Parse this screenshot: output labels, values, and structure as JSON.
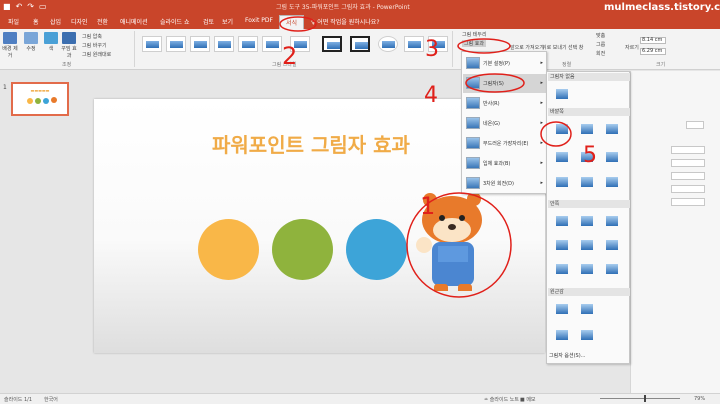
{
  "window": {
    "title": "그림 도구  35-파워포인트 그림자 효과 - PowerPoint",
    "watermark": "mulmeclass.tistory.com",
    "qat": [
      "save-icon",
      "undo-icon",
      "redo-icon",
      "present-icon"
    ],
    "qat_glyphs": [
      "■",
      "↶",
      "↷",
      "▭"
    ]
  },
  "tabs": [
    {
      "label": "파일"
    },
    {
      "label": "홈"
    },
    {
      "label": "삽입"
    },
    {
      "label": "디자인"
    },
    {
      "label": "전환"
    },
    {
      "label": "애니메이션"
    },
    {
      "label": "슬라이드 쇼"
    },
    {
      "label": "검토"
    },
    {
      "label": "보기"
    },
    {
      "label": "Foxit PDF"
    },
    {
      "label": "서식"
    }
  ],
  "tell_me": "♀ 어떤 작업을 원하시나요?",
  "ribbon": {
    "adjust": {
      "buttons": [
        "배경 제거",
        "수정",
        "색",
        "꾸밈 효과"
      ],
      "small": [
        "그림 압축",
        "그림 바꾸기",
        "그림 원래대로"
      ],
      "label": "조정"
    },
    "styles_label": "그림 스타일",
    "right_small": [
      "그림 테두리",
      "그림 효과",
      "그림 레이아웃",
      "앞으로 가져오기",
      "뒤로 보내기",
      "선택 창",
      "맞춤",
      "그룹",
      "회전"
    ],
    "size": {
      "height": "8.14 cm",
      "width": "6.29 cm",
      "label": "크기",
      "crop": "자르기"
    },
    "arrange_label": "정렬"
  },
  "effects_menu": {
    "items": [
      {
        "label": "기본 설정(P)"
      },
      {
        "label": "그림자(S)"
      },
      {
        "label": "반사(R)"
      },
      {
        "label": "네온(G)"
      },
      {
        "label": "부드러운 가장자리(E)"
      },
      {
        "label": "입체 효과(B)"
      },
      {
        "label": "3차원 회전(D)"
      }
    ],
    "arrow": "▸"
  },
  "shadow_menu": {
    "no_shadow": "그림자 없음",
    "outer": "바깥쪽",
    "inner": "안쪽",
    "perspective": "원근감",
    "options": "그림자 옵션(S)..."
  },
  "slide": {
    "title": "파워포인트 그림자 효과",
    "circles": [
      "#f9b748",
      "#8fb33d",
      "#3da4d8"
    ],
    "thumb_number": "1"
  },
  "status": {
    "slide": "슬라이드 1/1",
    "lang": "한국어",
    "notes": "≐ 슬라이드 노트",
    "memo": "■ 메모",
    "zoom": "79%"
  },
  "annotations": [
    "1",
    "2",
    "3",
    "4",
    "5"
  ]
}
